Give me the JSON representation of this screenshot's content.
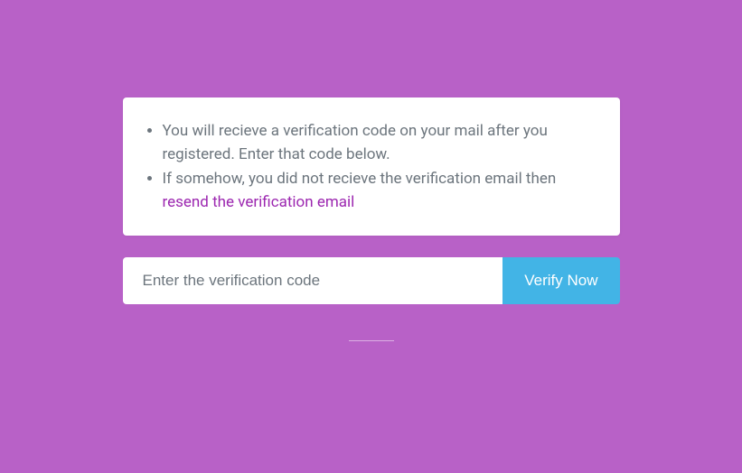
{
  "info": {
    "item1": "You will recieve a verification code on your mail after you registered. Enter that code below.",
    "item2_prefix": "If somehow, you did not recieve the verification email then ",
    "resend_link": "resend the verification email"
  },
  "form": {
    "code_placeholder": "Enter the verification code",
    "verify_label": "Verify Now"
  },
  "colors": {
    "background": "#b861c7",
    "card_bg": "#ffffff",
    "text_muted": "#6c757d",
    "link": "#9c27b0",
    "button_bg": "#42b4e6",
    "button_text": "#ffffff"
  }
}
